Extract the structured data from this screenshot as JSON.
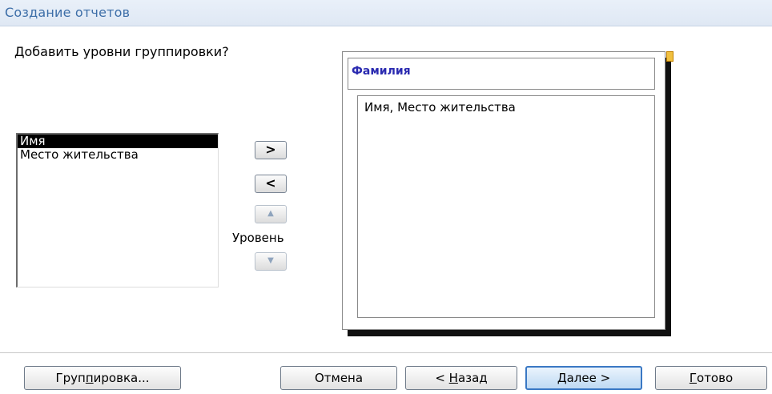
{
  "window": {
    "title": "Создание отчетов"
  },
  "question": "Добавить уровни группировки?",
  "fields": [
    "Имя",
    "Место жительства"
  ],
  "selected_field_index": 0,
  "buttons": {
    "add": ">",
    "remove": "<",
    "level_label": "Уровень"
  },
  "preview": {
    "group_header": "Фамилия",
    "detail_text": "Имя, Место жительства"
  },
  "footer": {
    "grouping_pre": "Груп",
    "grouping_acc": "п",
    "grouping_post": "ировка...",
    "cancel": "Отмена",
    "back_pre": "< ",
    "back_acc": "Н",
    "back_post": "азад",
    "next_acc": "Д",
    "next_post": "алее >",
    "finish_acc": "Г",
    "finish_post": "отово"
  },
  "colors": {
    "title_text": "#3d6ea8",
    "group_header_text": "#2a2ab0",
    "default_button_border": "#3a78c4"
  }
}
